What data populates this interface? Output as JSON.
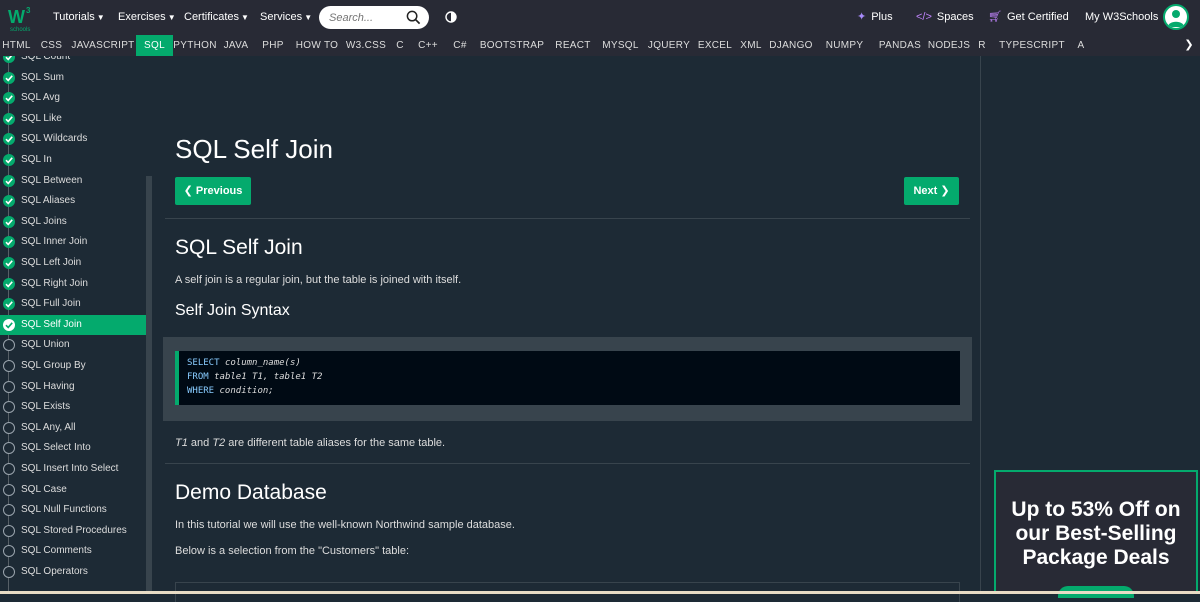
{
  "brand": {
    "logo_letter": "W",
    "logo_sup": "3",
    "logo_sub": "schools"
  },
  "topnav": {
    "tutorials": "Tutorials",
    "exercises": "Exercises",
    "certificates": "Certificates",
    "services": "Services",
    "search_placeholder": "Search...",
    "plus": "Plus",
    "spaces": "Spaces",
    "get_certified": "Get Certified",
    "my_w3schools": "My W3Schools"
  },
  "subnav": {
    "items": [
      "HTML",
      "CSS",
      "JAVASCRIPT",
      "SQL",
      "PYTHON",
      "JAVA",
      "PHP",
      "HOW TO",
      "W3.CSS",
      "C",
      "C++",
      "C#",
      "BOOTSTRAP",
      "REACT",
      "MYSQL",
      "JQUERY",
      "EXCEL",
      "XML",
      "DJANGO",
      "NUMPY",
      "PANDAS",
      "NODEJS",
      "R",
      "TYPESCRIPT",
      "A"
    ],
    "active": "SQL"
  },
  "sidebar": {
    "items": [
      {
        "label": "SQL Count",
        "state": "done"
      },
      {
        "label": "SQL Sum",
        "state": "done"
      },
      {
        "label": "SQL Avg",
        "state": "done"
      },
      {
        "label": "SQL Like",
        "state": "done"
      },
      {
        "label": "SQL Wildcards",
        "state": "done"
      },
      {
        "label": "SQL In",
        "state": "done"
      },
      {
        "label": "SQL Between",
        "state": "done"
      },
      {
        "label": "SQL Aliases",
        "state": "done"
      },
      {
        "label": "SQL Joins",
        "state": "done"
      },
      {
        "label": "SQL Inner Join",
        "state": "done"
      },
      {
        "label": "SQL Left Join",
        "state": "done"
      },
      {
        "label": "SQL Right Join",
        "state": "done"
      },
      {
        "label": "SQL Full Join",
        "state": "done"
      },
      {
        "label": "SQL Self Join",
        "state": "active"
      },
      {
        "label": "SQL Union",
        "state": "todo"
      },
      {
        "label": "SQL Group By",
        "state": "todo"
      },
      {
        "label": "SQL Having",
        "state": "todo"
      },
      {
        "label": "SQL Exists",
        "state": "todo"
      },
      {
        "label": "SQL Any, All",
        "state": "todo"
      },
      {
        "label": "SQL Select Into",
        "state": "todo"
      },
      {
        "label": "SQL Insert Into Select",
        "state": "todo"
      },
      {
        "label": "SQL Case",
        "state": "todo"
      },
      {
        "label": "SQL Null Functions",
        "state": "todo"
      },
      {
        "label": "SQL Stored Procedures",
        "state": "todo"
      },
      {
        "label": "SQL Comments",
        "state": "todo"
      },
      {
        "label": "SQL Operators",
        "state": "todo"
      }
    ]
  },
  "main": {
    "page_title": "SQL Self Join",
    "prev_label": "Previous",
    "next_label": "Next",
    "h2_self_join": "SQL Self Join",
    "intro": "A self join is a regular join, but the table is joined with itself.",
    "h3_syntax": "Self Join Syntax",
    "code": {
      "line1_kw": "SELECT",
      "line1_rest": "column_name(s)",
      "line2_kw": "FROM",
      "line2_rest": "table1 T1, table1 T2",
      "line3_kw": "WHERE",
      "line3_rest": "condition;"
    },
    "alias_t1": "T1",
    "alias_and": "and",
    "alias_t2": "T2",
    "alias_rest": "are different table aliases for the same table.",
    "h2_demo": "Demo Database",
    "demo_p1": "In this tutorial we will use the well-known Northwind sample database.",
    "demo_p2": "Below is a selection from the \"Customers\" table:"
  },
  "ad": {
    "text": "Up to 53% Off on our Best-Selling Package Deals"
  },
  "colors": {
    "accent": "#04aa6d",
    "bg": "#1d2a35",
    "nav": "#282a35"
  }
}
